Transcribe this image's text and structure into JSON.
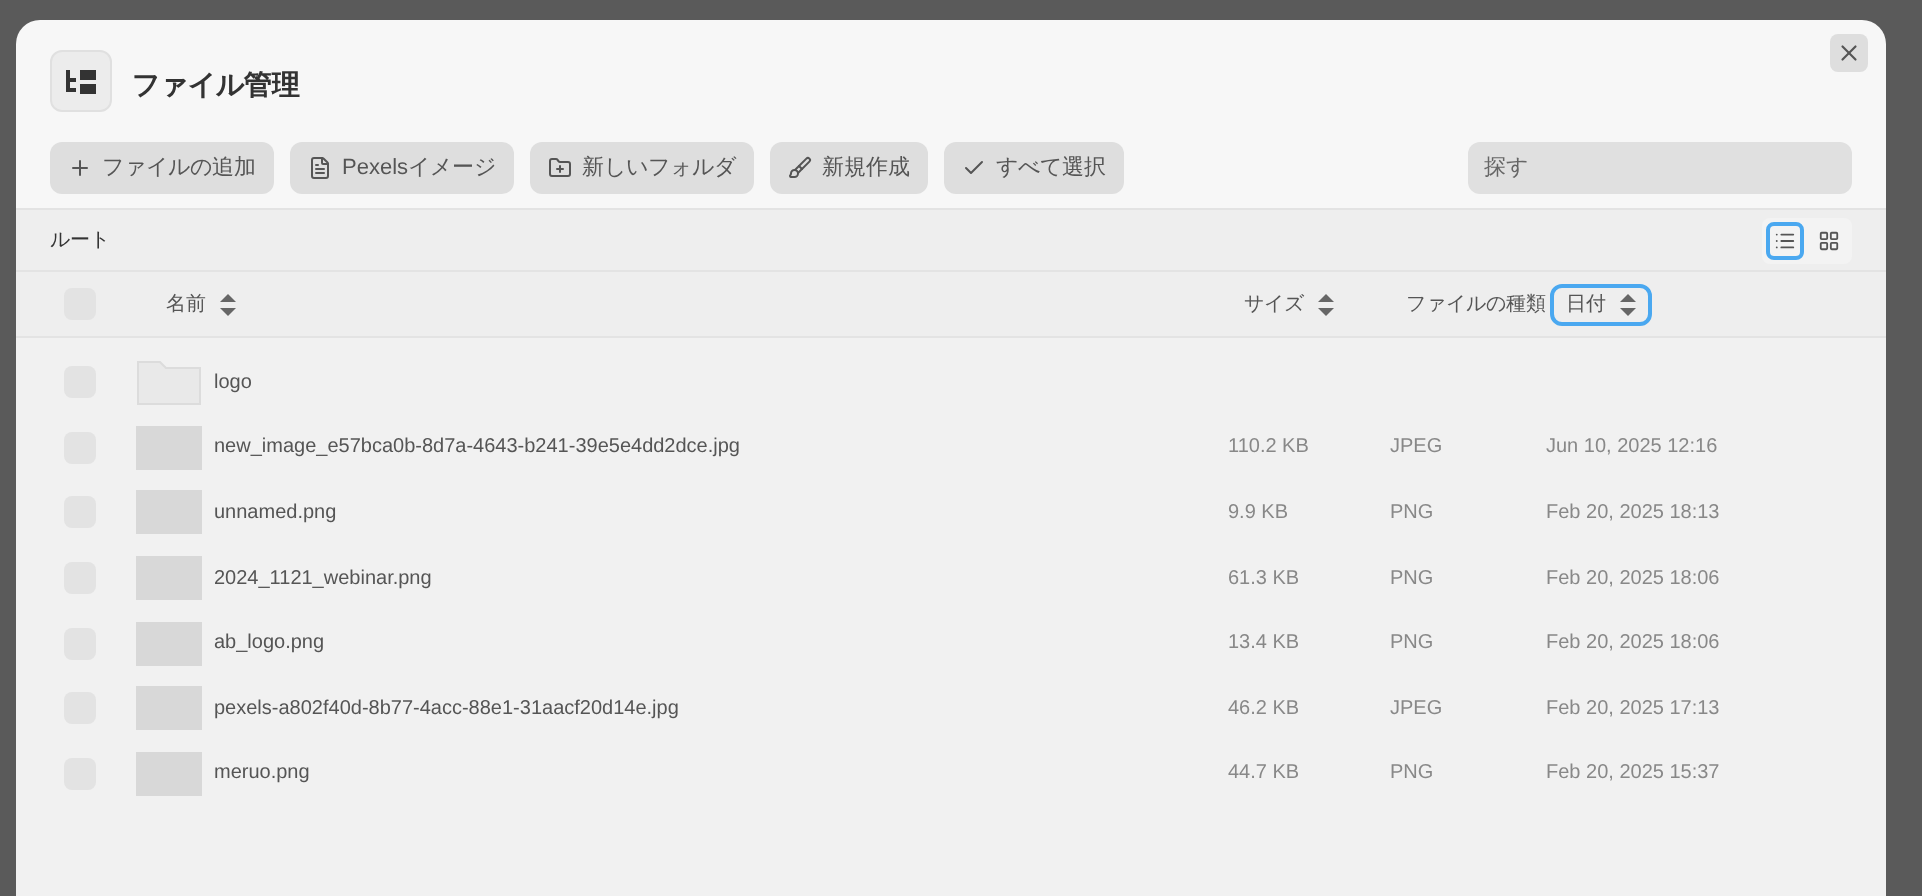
{
  "window": {
    "title": "ファイル管理"
  },
  "toolbar": [
    {
      "kind": "add",
      "label": "ファイルの追加"
    },
    {
      "kind": "pexels",
      "label": "Pexelsイメージ"
    },
    {
      "kind": "folder",
      "label": "新しいフォルダ"
    },
    {
      "kind": "create",
      "label": "新規作成"
    },
    {
      "kind": "select",
      "label": "すべて選択"
    }
  ],
  "search": {
    "placeholder": "探す"
  },
  "breadcrumb": "ルート",
  "view_toggle": [
    {
      "kind": "list",
      "selected": true
    },
    {
      "kind": "grid",
      "selected": false
    }
  ],
  "table": {
    "select_all": {
      "checked": false
    },
    "columns": [
      {
        "label": "名前",
        "sortable": true,
        "selected": false
      },
      {
        "label": "サイズ",
        "sortable": true,
        "selected": false
      },
      {
        "label": "ファイルの種類",
        "sortable": false,
        "selected": false
      },
      {
        "label": "日付",
        "sortable": true,
        "selected": true
      }
    ],
    "rows": [
      {
        "kind": "folder",
        "checked": false,
        "name": "logo"
      },
      {
        "kind": "file",
        "checked": false,
        "name": "new_image_e57bca0b-8d7a-4643-b241-39e5e4dd2dce.jpg",
        "size": "110.2 KB",
        "type": "JPEG",
        "date": "Jun 10, 2025 12:16"
      },
      {
        "kind": "file",
        "checked": false,
        "name": "unnamed.png",
        "size": "9.9 KB",
        "type": "PNG",
        "date": "Feb 20, 2025 18:13"
      },
      {
        "kind": "file",
        "checked": false,
        "name": "2024_1121_webinar.png",
        "size": "61.3 KB",
        "type": "PNG",
        "date": "Feb 20, 2025 18:06"
      },
      {
        "kind": "file",
        "checked": false,
        "name": "ab_logo.png",
        "size": "13.4 KB",
        "type": "PNG",
        "date": "Feb 20, 2025 18:06"
      },
      {
        "kind": "file",
        "checked": false,
        "name": "pexels-a802f40d-8b77-4acc-88e1-31aacf20d14e.jpg",
        "size": "46.2 KB",
        "type": "JPEG",
        "date": "Feb 20, 2025 17:13"
      },
      {
        "kind": "file",
        "checked": false,
        "name": "meruo.png",
        "size": "44.7 KB",
        "type": "PNG",
        "date": "Feb 20, 2025 15:37"
      }
    ]
  }
}
